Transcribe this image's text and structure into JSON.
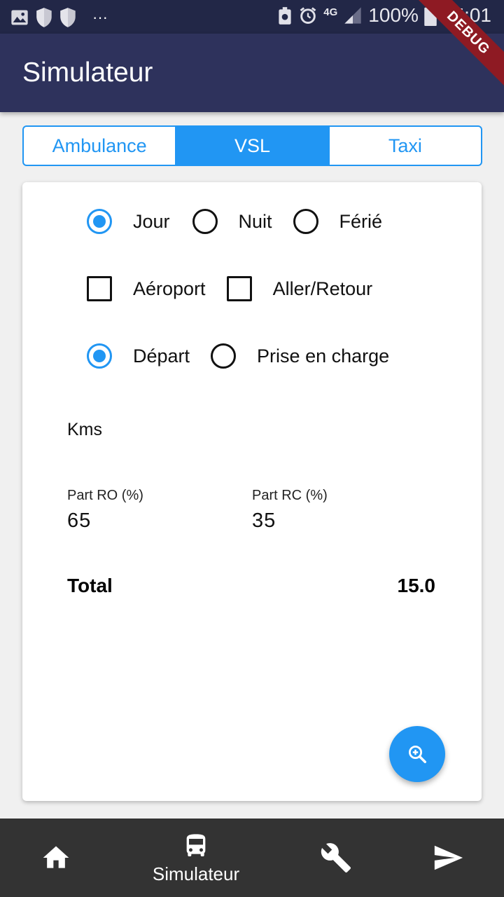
{
  "status_bar": {
    "battery": "100%",
    "time": "15:01",
    "network": "4G",
    "overflow": "···"
  },
  "app_bar": {
    "title": "Simulateur",
    "debug_banner": "DEBUG"
  },
  "vehicle_tabs": [
    {
      "label": "Ambulance",
      "selected": false
    },
    {
      "label": "VSL",
      "selected": true
    },
    {
      "label": "Taxi",
      "selected": false
    }
  ],
  "period": {
    "options": [
      "Jour",
      "Nuit",
      "Férié"
    ],
    "selected": "Jour"
  },
  "extras": {
    "options": [
      "Aéroport",
      "Aller/Retour"
    ],
    "checked": []
  },
  "start_point": {
    "options": [
      "Départ",
      "Prise en charge"
    ],
    "selected": "Départ"
  },
  "kms": {
    "label": "Kms",
    "value": ""
  },
  "part_ro": {
    "label": "Part RO (%)",
    "value": "65"
  },
  "part_rc": {
    "label": "Part RC (%)",
    "value": "35"
  },
  "total": {
    "label": "Total",
    "value": "15.0"
  },
  "fab": {
    "icon": "zoom-in-icon"
  },
  "bottom_nav": {
    "items": [
      {
        "icon": "home-icon",
        "label": ""
      },
      {
        "icon": "bus-icon",
        "label": "Simulateur",
        "active": true
      },
      {
        "icon": "wrench-icon",
        "label": ""
      },
      {
        "icon": "send-icon",
        "label": ""
      }
    ]
  },
  "colors": {
    "primary": "#2196f3",
    "app_bar": "#2e325c",
    "status_bar": "#222747",
    "bottom_nav": "#333333",
    "debug": "#8e1a23"
  }
}
